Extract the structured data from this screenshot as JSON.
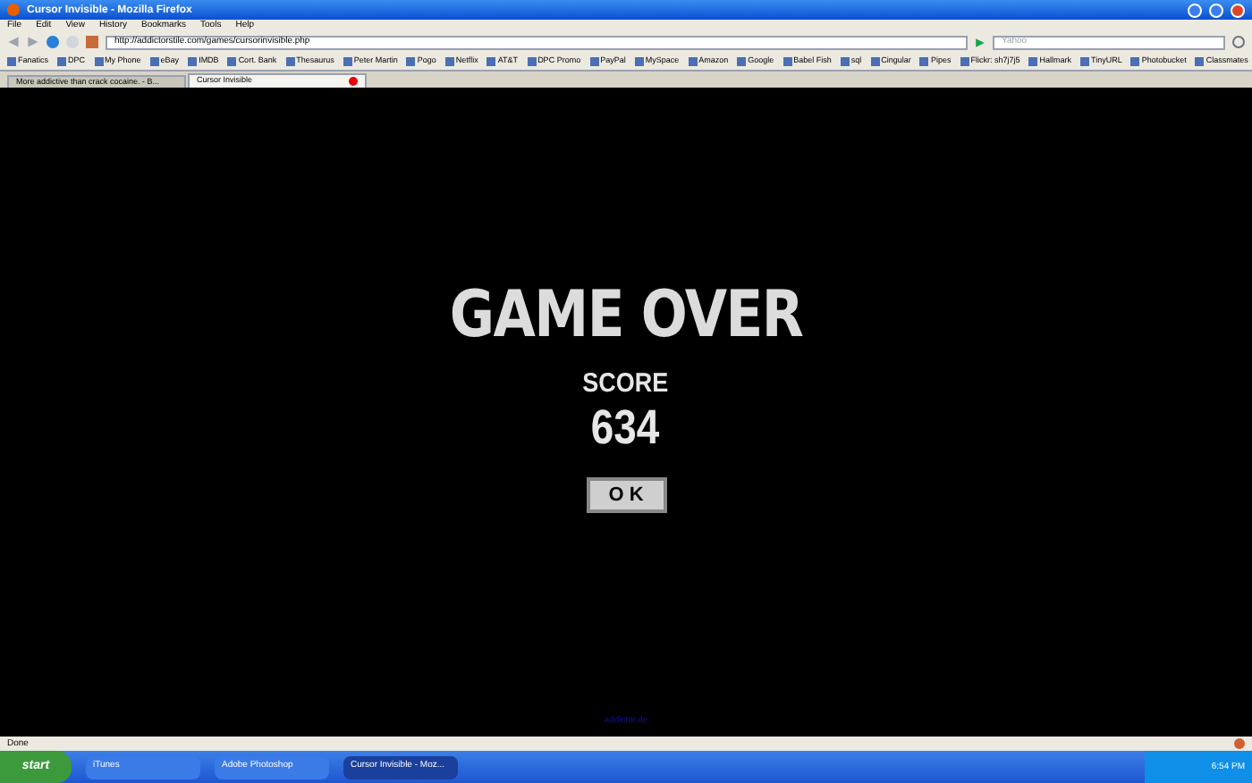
{
  "window": {
    "title": "Cursor Invisible - Mozilla Firefox"
  },
  "menu": [
    "File",
    "Edit",
    "View",
    "History",
    "Bookmarks",
    "Tools",
    "Help"
  ],
  "address": {
    "value": "http://addictorstile.com/games/cursorinvisible.php"
  },
  "search": {
    "placeholder": "Yahoo"
  },
  "bookmarks": [
    "Fanatics",
    "DPC",
    "My Phone",
    "eBay",
    "IMDB",
    "Cort. Bank",
    "Thesaurus",
    "Peter Martin",
    "Pogo",
    "Netflix",
    "AT&T",
    "DPC Promo",
    "PayPal",
    "MySpace",
    "Amazon",
    "Google",
    "Babel Fish",
    "sql",
    "Cingular",
    "Pipes",
    "Flickr: sh7j7j5",
    "Hallmark",
    "TinyURL",
    "Photobucket",
    "Classmates"
  ],
  "tabs": [
    {
      "label": "More addictive than crack cocaine. - B...",
      "selected": false
    },
    {
      "label": "Cursor Invisible",
      "selected": true
    }
  ],
  "game": {
    "heading": "GAME OVER",
    "score_label": "SCORE",
    "score": "634",
    "button": "O K",
    "footer_link": "addictor.de"
  },
  "status_bar": {
    "text": "Done"
  },
  "taskbar": {
    "start": "start",
    "items": [
      {
        "label": "iTunes",
        "selected": false
      },
      {
        "label": "Adobe Photoshop",
        "selected": false
      },
      {
        "label": "Cursor Invisible - Moz...",
        "selected": true
      }
    ],
    "clock": "6:54 PM"
  }
}
